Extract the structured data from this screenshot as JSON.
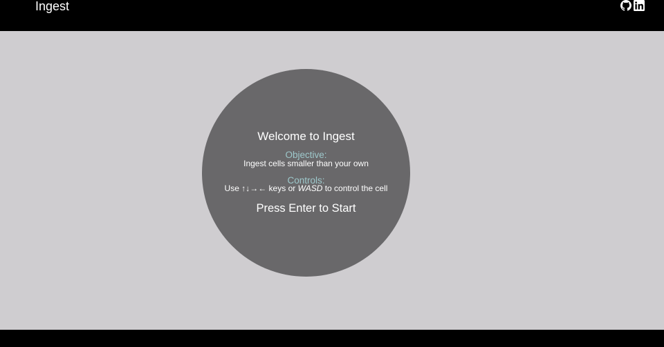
{
  "header": {
    "title": "Ingest",
    "links": [
      {
        "icon": "github-icon"
      },
      {
        "icon": "linkedin-icon"
      }
    ]
  },
  "menu": {
    "welcome": "Welcome to Ingest",
    "objective": {
      "heading": "Objective:",
      "text": "Ingest cells smaller than your own"
    },
    "controls": {
      "heading": "Controls:",
      "prefix": "Use ↑↓→← keys or",
      "keys": "WASD",
      "suffix": "to control the cell"
    },
    "start_prompt": "Press Enter to Start"
  },
  "colors": {
    "background": "#cfcdd0",
    "bars": "#000000",
    "cell": "#69686a",
    "heading_accent": "#9ec9cc",
    "text": "#ffffff"
  }
}
